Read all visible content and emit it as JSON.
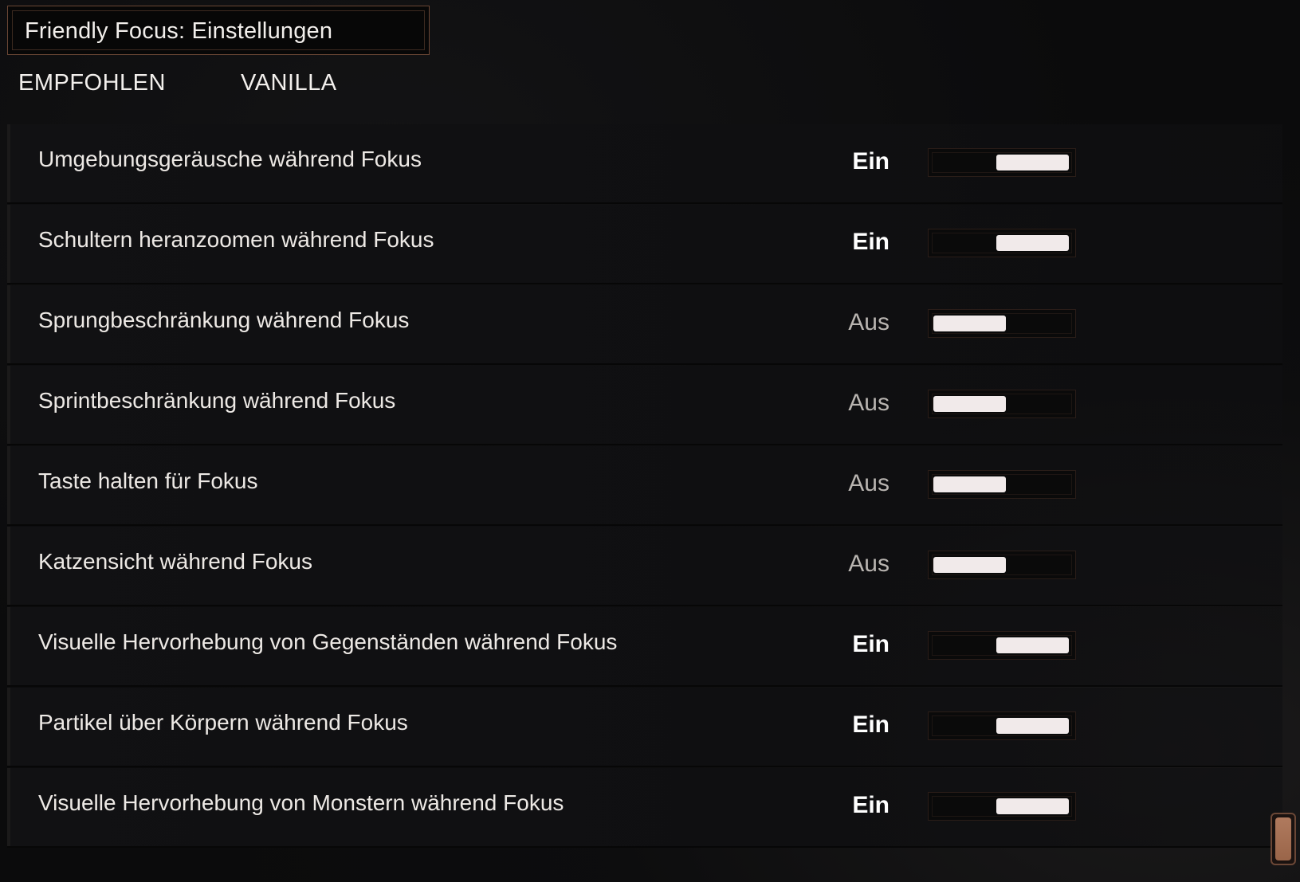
{
  "header": {
    "title": "Friendly Focus: Einstellungen"
  },
  "presets": {
    "recommended_label": "EMPFOHLEN",
    "vanilla_label": "VANILLA"
  },
  "settings": [
    {
      "label": "Umgebungsgeräusche während Fokus",
      "state": "Ein",
      "enabled": true
    },
    {
      "label": "Schultern heranzoomen während Fokus",
      "state": "Ein",
      "enabled": true
    },
    {
      "label": "Sprungbeschränkung während Fokus",
      "state": "Aus",
      "enabled": false
    },
    {
      "label": "Sprintbeschränkung während Fokus",
      "state": "Aus",
      "enabled": false
    },
    {
      "label": "Taste halten für Fokus",
      "state": "Aus",
      "enabled": false
    },
    {
      "label": "Katzensicht während Fokus",
      "state": "Aus",
      "enabled": false
    },
    {
      "label": "Visuelle Hervorhebung von Gegenständen während Fokus",
      "state": "Ein",
      "enabled": true
    },
    {
      "label": "Partikel über Körpern während Fokus",
      "state": "Ein",
      "enabled": true
    },
    {
      "label": "Visuelle Hervorhebung von Monstern während Fokus",
      "state": "Ein",
      "enabled": true
    }
  ],
  "colors": {
    "accent_border": "#6a4634",
    "scroll_thumb": "#a06b4f",
    "knob": "#f1eaea"
  }
}
